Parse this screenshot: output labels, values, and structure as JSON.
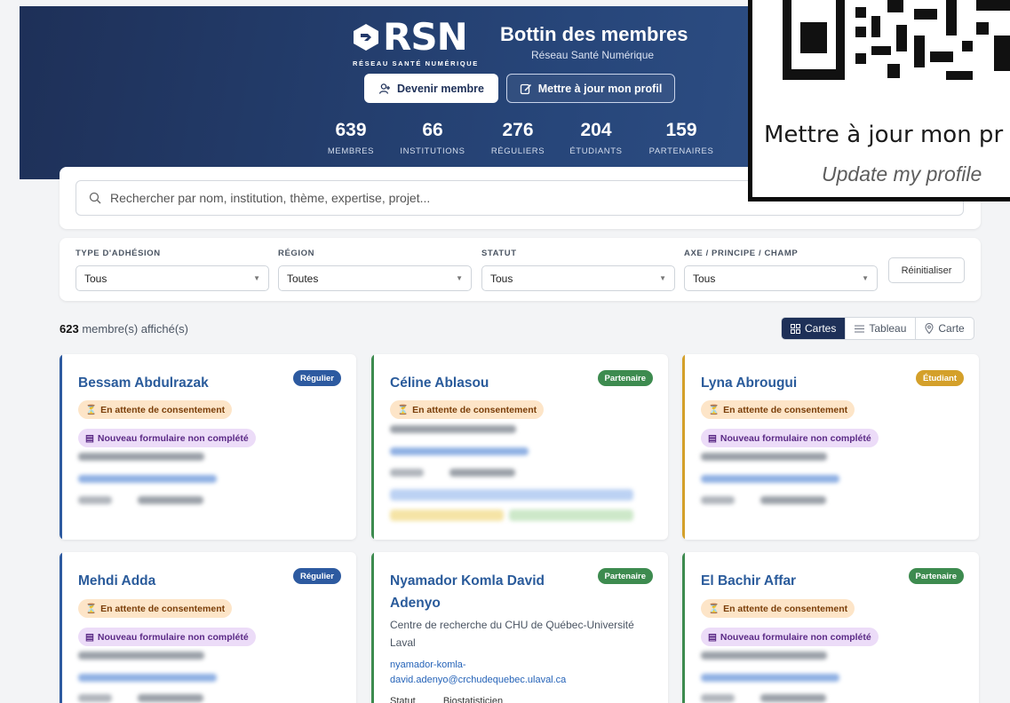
{
  "brand": {
    "logo_text": "RSN",
    "tagline": "RÉSEAU SANTÉ NUMÉRIQUE"
  },
  "header": {
    "title": "Bottin des membres",
    "subtitle": "Réseau Santé Numérique"
  },
  "actions": {
    "join_label": "Devenir membre",
    "update_label": "Mettre à jour mon profil"
  },
  "stats": [
    {
      "value": "639",
      "label": "MEMBRES"
    },
    {
      "value": "66",
      "label": "INSTITUTIONS"
    },
    {
      "value": "276",
      "label": "RÉGULIERS"
    },
    {
      "value": "204",
      "label": "ÉTUDIANTS"
    },
    {
      "value": "159",
      "label": "PARTENAIRES"
    }
  ],
  "qr_overlay": {
    "title": "Mettre à jour mon pr",
    "subtitle": "Update my profile"
  },
  "search": {
    "placeholder": "Rechercher par nom, institution, thème, expertise, projet..."
  },
  "filters": [
    {
      "label": "TYPE D'ADHÉSION",
      "value": "Tous"
    },
    {
      "label": "RÉGION",
      "value": "Toutes"
    },
    {
      "label": "STATUT",
      "value": "Tous"
    },
    {
      "label": "AXE / PRINCIPE / CHAMP",
      "value": "Tous"
    }
  ],
  "reset_label": "Réinitialiser",
  "results": {
    "count": "623",
    "suffix": "membre(s) affiché(s)"
  },
  "views": [
    {
      "label": "Cartes",
      "icon": "grid-icon",
      "active": true
    },
    {
      "label": "Tableau",
      "icon": "list-icon",
      "active": false
    },
    {
      "label": "Carte",
      "icon": "map-pin-icon",
      "active": false
    }
  ],
  "badges": {
    "pending": "En attente de consentement",
    "form": "Nouveau formulaire non complété"
  },
  "colors": {
    "regulier": "#2d5aa0",
    "partenaire": "#3d8b4f",
    "etudiant": "#d4a02a",
    "navy": "#1e3058"
  },
  "members": [
    {
      "name": "Bessam Abdulrazak",
      "type": "Régulier"
    },
    {
      "name": "Céline Ablasou",
      "type": "Partenaire"
    },
    {
      "name": "Lyna Abrougui",
      "type": "Étudiant"
    },
    {
      "name": "Mehdi Adda",
      "type": "Régulier"
    },
    {
      "name_line1": "Nyamador Komla David",
      "name_line2": "Adenyo",
      "type": "Partenaire",
      "institution_line1": "Centre de recherche du CHU de Québec-Université",
      "institution_line2": "Laval",
      "email_line1": "nyamador-komla-",
      "email_line2": "david.adenyo@crchudequebec.ulaval.ca",
      "statut_label": "Statut",
      "statut_value": "Biostatisticien"
    },
    {
      "name": "El Bachir Affar",
      "type": "Partenaire"
    }
  ]
}
